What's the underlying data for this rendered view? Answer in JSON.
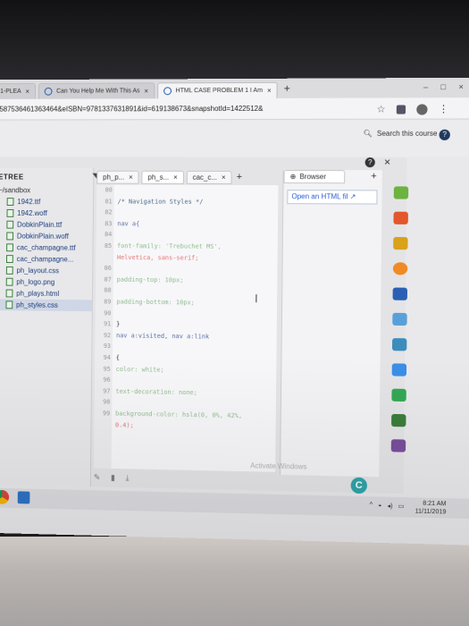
{
  "browser": {
    "tabs": [
      {
        "label": "1-PLEA",
        "close": "×"
      },
      {
        "label": "Can You Help Me With This As",
        "close": "×"
      },
      {
        "label": "HTML CASE PROBLEM 1 I Am",
        "close": "×"
      }
    ],
    "new_tab": "+",
    "address": "1587536461363464&eISBN=9781337631891&id=619138673&snapshotId=1422512&",
    "window_controls": [
      "–",
      "□",
      "×"
    ]
  },
  "course": {
    "search_placeholder": "Search this course",
    "help_icon": "?"
  },
  "ide": {
    "close": "×",
    "help": "?",
    "file_tree": {
      "title": "ETREE",
      "root": "~/sandbox",
      "files": [
        "1942.ttf",
        "1942.woff",
        "DobkinPlain.ttf",
        "DobkinPlain.woff",
        "cac_champagne.ttf",
        "cac_champagne...",
        "ph_layout.css",
        "ph_logo.png",
        "ph_plays.html",
        "ph_styles.css"
      ]
    },
    "editor_tabs": [
      {
        "label": "ph_p...",
        "close": "×"
      },
      {
        "label": "ph_s...",
        "close": "×"
      },
      {
        "label": "cac_c...",
        "close": "×"
      }
    ],
    "editor_plus": "+",
    "code_lines": [
      {
        "n": "80",
        "text": ""
      },
      {
        "n": "81",
        "text": "/* Navigation Styles */"
      },
      {
        "n": "82",
        "text": ""
      },
      {
        "n": "83",
        "text": "nav a{"
      },
      {
        "n": "84",
        "text": ""
      },
      {
        "n": "85",
        "text": "font-family: 'Trebuchet MS',"
      },
      {
        "n": "",
        "text": "Helvetica, sans-serif;"
      },
      {
        "n": "86",
        "text": ""
      },
      {
        "n": "87",
        "text": "padding-top: 10px;"
      },
      {
        "n": "88",
        "text": ""
      },
      {
        "n": "89",
        "text": "padding-bottom: 10px;"
      },
      {
        "n": "90",
        "text": ""
      },
      {
        "n": "91",
        "text": "}"
      },
      {
        "n": "92",
        "text": "nav a:visited, nav a:link"
      },
      {
        "n": "93",
        "text": ""
      },
      {
        "n": "94",
        "text": "{"
      },
      {
        "n": "95",
        "text": "color: white;"
      },
      {
        "n": "96",
        "text": ""
      },
      {
        "n": "97",
        "text": "text-decoration: none;"
      },
      {
        "n": "98",
        "text": ""
      },
      {
        "n": "99",
        "text": "background-color: hsla(0, 0%, 42%,"
      },
      {
        "n": "",
        "text": "0.4);"
      }
    ],
    "browser_pane": {
      "tab_label": "Browser",
      "plus": "+",
      "open_field": "Open an HTML fil"
    },
    "activate_text": "Activate Windows"
  },
  "taskbar": {
    "time": "8:21 AM",
    "date": "11/11/2019"
  }
}
